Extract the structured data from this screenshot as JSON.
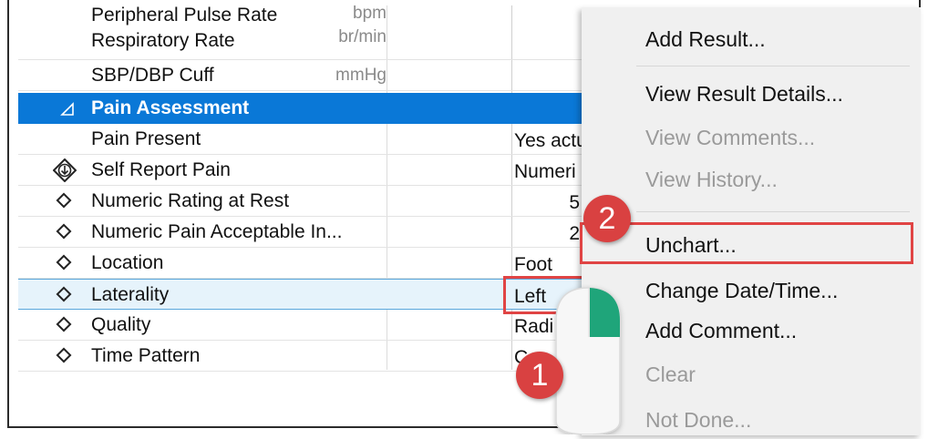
{
  "grid": {
    "rows": [
      {
        "label": "Peripheral Pulse Rate",
        "unit": "bpm",
        "value": ""
      },
      {
        "label": "Respiratory Rate",
        "unit": "br/min",
        "value": ""
      },
      {
        "label": "SBP/DBP Cuff",
        "unit": "mmHg",
        "value": ""
      },
      {
        "label": "Pain Assessment",
        "unit": "",
        "value": ""
      },
      {
        "label": "Pain Present",
        "unit": "",
        "value": "Yes actu"
      },
      {
        "label": "Self Report Pain",
        "unit": "",
        "value": "Numeri"
      },
      {
        "label": "Numeric Rating at Rest",
        "unit": "",
        "value": "5"
      },
      {
        "label": "Numeric Pain Acceptable In...",
        "unit": "",
        "value": "2"
      },
      {
        "label": "Location",
        "unit": "",
        "value": "Foot"
      },
      {
        "label": "Laterality",
        "unit": "",
        "value": "Left"
      },
      {
        "label": "Quality",
        "unit": "",
        "value": "Radi"
      },
      {
        "label": "Time Pattern",
        "unit": "",
        "value": "C"
      }
    ]
  },
  "menu": {
    "items": [
      {
        "label": "Add Result...",
        "enabled": true
      },
      {
        "label": "View Result Details...",
        "enabled": true
      },
      {
        "label": "View Comments...",
        "enabled": false
      },
      {
        "label": "View History...",
        "enabled": false
      },
      {
        "label": "Unchart...",
        "enabled": true
      },
      {
        "label": "Change Date/Time...",
        "enabled": true
      },
      {
        "label": "Add Comment...",
        "enabled": true
      },
      {
        "label": "Clear",
        "enabled": false
      },
      {
        "label": "Not Done...",
        "enabled": false
      }
    ]
  },
  "callouts": {
    "step1": "1",
    "step2": "2"
  },
  "icons": {
    "collapse": "collapse-triangle-icon",
    "diamond": "diamond-icon",
    "diamond_arrow": "diamond-arrow-icon",
    "mouse": "mouse-right-click-icon"
  },
  "colors": {
    "section_bg": "#0a78d7",
    "highlight": "#e04444",
    "badge": "#d94141",
    "menu_bg": "#f0f0f0",
    "mouse_button": "#1fa57a"
  }
}
